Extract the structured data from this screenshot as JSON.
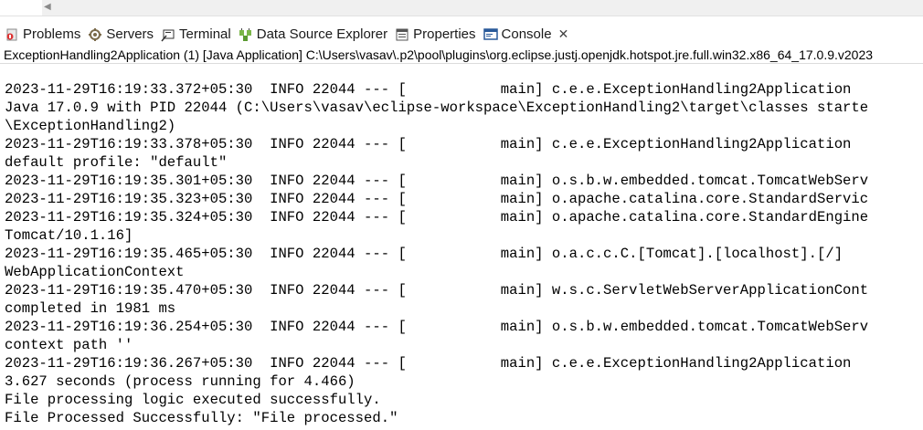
{
  "tabs": [
    {
      "label": "Problems",
      "icon": "problems-icon"
    },
    {
      "label": "Servers",
      "icon": "servers-icon"
    },
    {
      "label": "Terminal",
      "icon": "terminal-icon"
    },
    {
      "label": "Data Source Explorer",
      "icon": "data-source-explorer-icon"
    },
    {
      "label": "Properties",
      "icon": "properties-icon"
    },
    {
      "label": "Console",
      "icon": "console-icon",
      "active": true
    }
  ],
  "process_label": "ExceptionHandling2Application (1) [Java Application] C:\\Users\\vasav\\.p2\\pool\\plugins\\org.eclipse.justj.openjdk.hotspot.jre.full.win32.x86_64_17.0.9.v2023",
  "console_lines": [
    "2023-11-29T16:19:33.372+05:30  INFO 22044 --- [           main] c.e.e.ExceptionHandling2Application",
    "Java 17.0.9 with PID 22044 (C:\\Users\\vasav\\eclipse-workspace\\ExceptionHandling2\\target\\classes starte",
    "\\ExceptionHandling2)",
    "2023-11-29T16:19:33.378+05:30  INFO 22044 --- [           main] c.e.e.ExceptionHandling2Application",
    "default profile: \"default\"",
    "2023-11-29T16:19:35.301+05:30  INFO 22044 --- [           main] o.s.b.w.embedded.tomcat.TomcatWebServ",
    "2023-11-29T16:19:35.323+05:30  INFO 22044 --- [           main] o.apache.catalina.core.StandardServic",
    "2023-11-29T16:19:35.324+05:30  INFO 22044 --- [           main] o.apache.catalina.core.StandardEngine",
    "Tomcat/10.1.16]",
    "2023-11-29T16:19:35.465+05:30  INFO 22044 --- [           main] o.a.c.c.C.[Tomcat].[localhost].[/]",
    "WebApplicationContext",
    "2023-11-29T16:19:35.470+05:30  INFO 22044 --- [           main] w.s.c.ServletWebServerApplicationCont",
    "completed in 1981 ms",
    "2023-11-29T16:19:36.254+05:30  INFO 22044 --- [           main] o.s.b.w.embedded.tomcat.TomcatWebServ",
    "context path ''",
    "2023-11-29T16:19:36.267+05:30  INFO 22044 --- [           main] c.e.e.ExceptionHandling2Application",
    "3.627 seconds (process running for 4.466)",
    "File processing logic executed successfully.",
    "File Processed Successfully: \"File processed.\""
  ]
}
